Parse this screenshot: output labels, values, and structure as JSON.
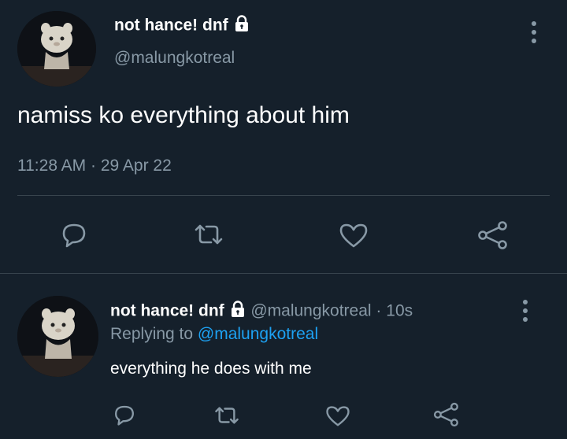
{
  "main_tweet": {
    "display_name": "not hance! dnf",
    "handle": "@malungkotreal",
    "text": "namiss ko everything about him",
    "time": "11:28 AM",
    "separator": "·",
    "date": "29 Apr 22",
    "icons": [
      "reply-icon",
      "retweet-icon",
      "like-icon",
      "share-icon"
    ]
  },
  "reply_tweet": {
    "display_name": "not hance! dnf",
    "handle": "@malungkotreal",
    "separator": "·",
    "age": "10s",
    "replying_prefix": "Replying to",
    "replying_handle": "@malungkotreal",
    "text": "everything he does with me",
    "icons": [
      "reply-icon",
      "retweet-icon",
      "like-icon",
      "share-icon"
    ]
  },
  "colors": {
    "background": "#15202b",
    "text": "#ffffff",
    "muted": "#8899a6",
    "link": "#1da1f2",
    "divider": "#38444d"
  }
}
